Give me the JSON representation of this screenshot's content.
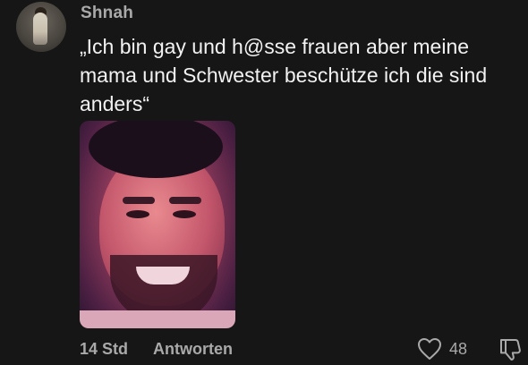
{
  "comment": {
    "username": "Shnah",
    "text": "„Ich bin gay und h@sse frauen aber meine mama und Schwester beschütze ich die sind anders“",
    "time": "14 Std",
    "reply_label": "Antworten",
    "like_count": "48"
  },
  "icons": {
    "like": "heart-outline-icon",
    "dislike": "thumbs-down-icon"
  },
  "colors": {
    "background": "#161616",
    "text": "#f2f2f2",
    "secondary": "#a9a9a9"
  }
}
